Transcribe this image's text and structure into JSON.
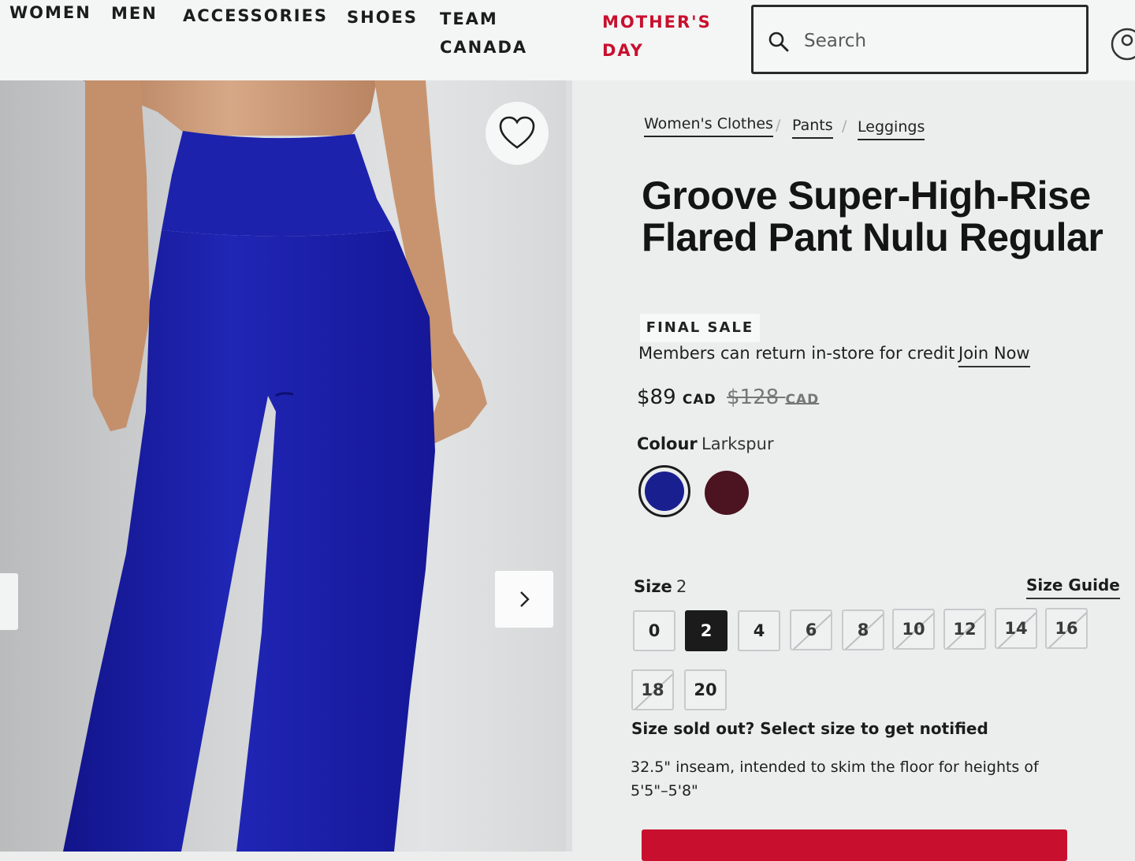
{
  "header": {
    "nav": [
      {
        "label": "WOMEN"
      },
      {
        "label": "MEN"
      },
      {
        "label": "ACCESSORIES"
      },
      {
        "label": "SHOES"
      },
      {
        "label": "TEAM\nCANADA"
      },
      {
        "label": "MOTHER'S\nDAY",
        "color": "#c8102e"
      }
    ],
    "search": {
      "placeholder": "Search",
      "value": ""
    }
  },
  "breadcrumb": [
    "Women's Clothes",
    "Pants",
    "Leggings"
  ],
  "breadcrumb_separator": "/",
  "product": {
    "title": "Groove Super-High-Rise Flared Pant Nulu Regular",
    "badge": "FINAL SALE",
    "members_text": "Members can return in-store for credit",
    "join_now": "Join Now",
    "price": {
      "current": "$89",
      "original": "$128",
      "currency": "CAD"
    },
    "colour": {
      "label": "Colour",
      "selected": "Larkspur",
      "swatches": [
        {
          "name": "Larkspur",
          "color": "#1a1f8f",
          "selected": true
        },
        {
          "color": "#4c1420",
          "selected": false
        }
      ]
    },
    "size": {
      "label": "Size",
      "selected": "2",
      "guide": "Size Guide",
      "options": [
        {
          "label": "0",
          "sold_out": false
        },
        {
          "label": "2",
          "sold_out": false
        },
        {
          "label": "4",
          "sold_out": false
        },
        {
          "label": "6",
          "sold_out": true
        },
        {
          "label": "8",
          "sold_out": true
        },
        {
          "label": "10",
          "sold_out": true
        },
        {
          "label": "12",
          "sold_out": true
        },
        {
          "label": "14",
          "sold_out": true
        },
        {
          "label": "16",
          "sold_out": true
        },
        {
          "label": "18",
          "sold_out": true
        },
        {
          "label": "20",
          "sold_out": false
        }
      ]
    },
    "sold_out_text": "Size sold out? Select size to get notified",
    "inseam_text": "32.5\" inseam, intended to skim the floor for heights of 5'5\"–5'8\""
  },
  "icons": {
    "search": "search-icon",
    "account": "account-icon",
    "favorite": "heart-icon",
    "next": "chevron-right-icon"
  },
  "colors": {
    "accent": "#c8102e",
    "legging": "#1c1fa6"
  }
}
